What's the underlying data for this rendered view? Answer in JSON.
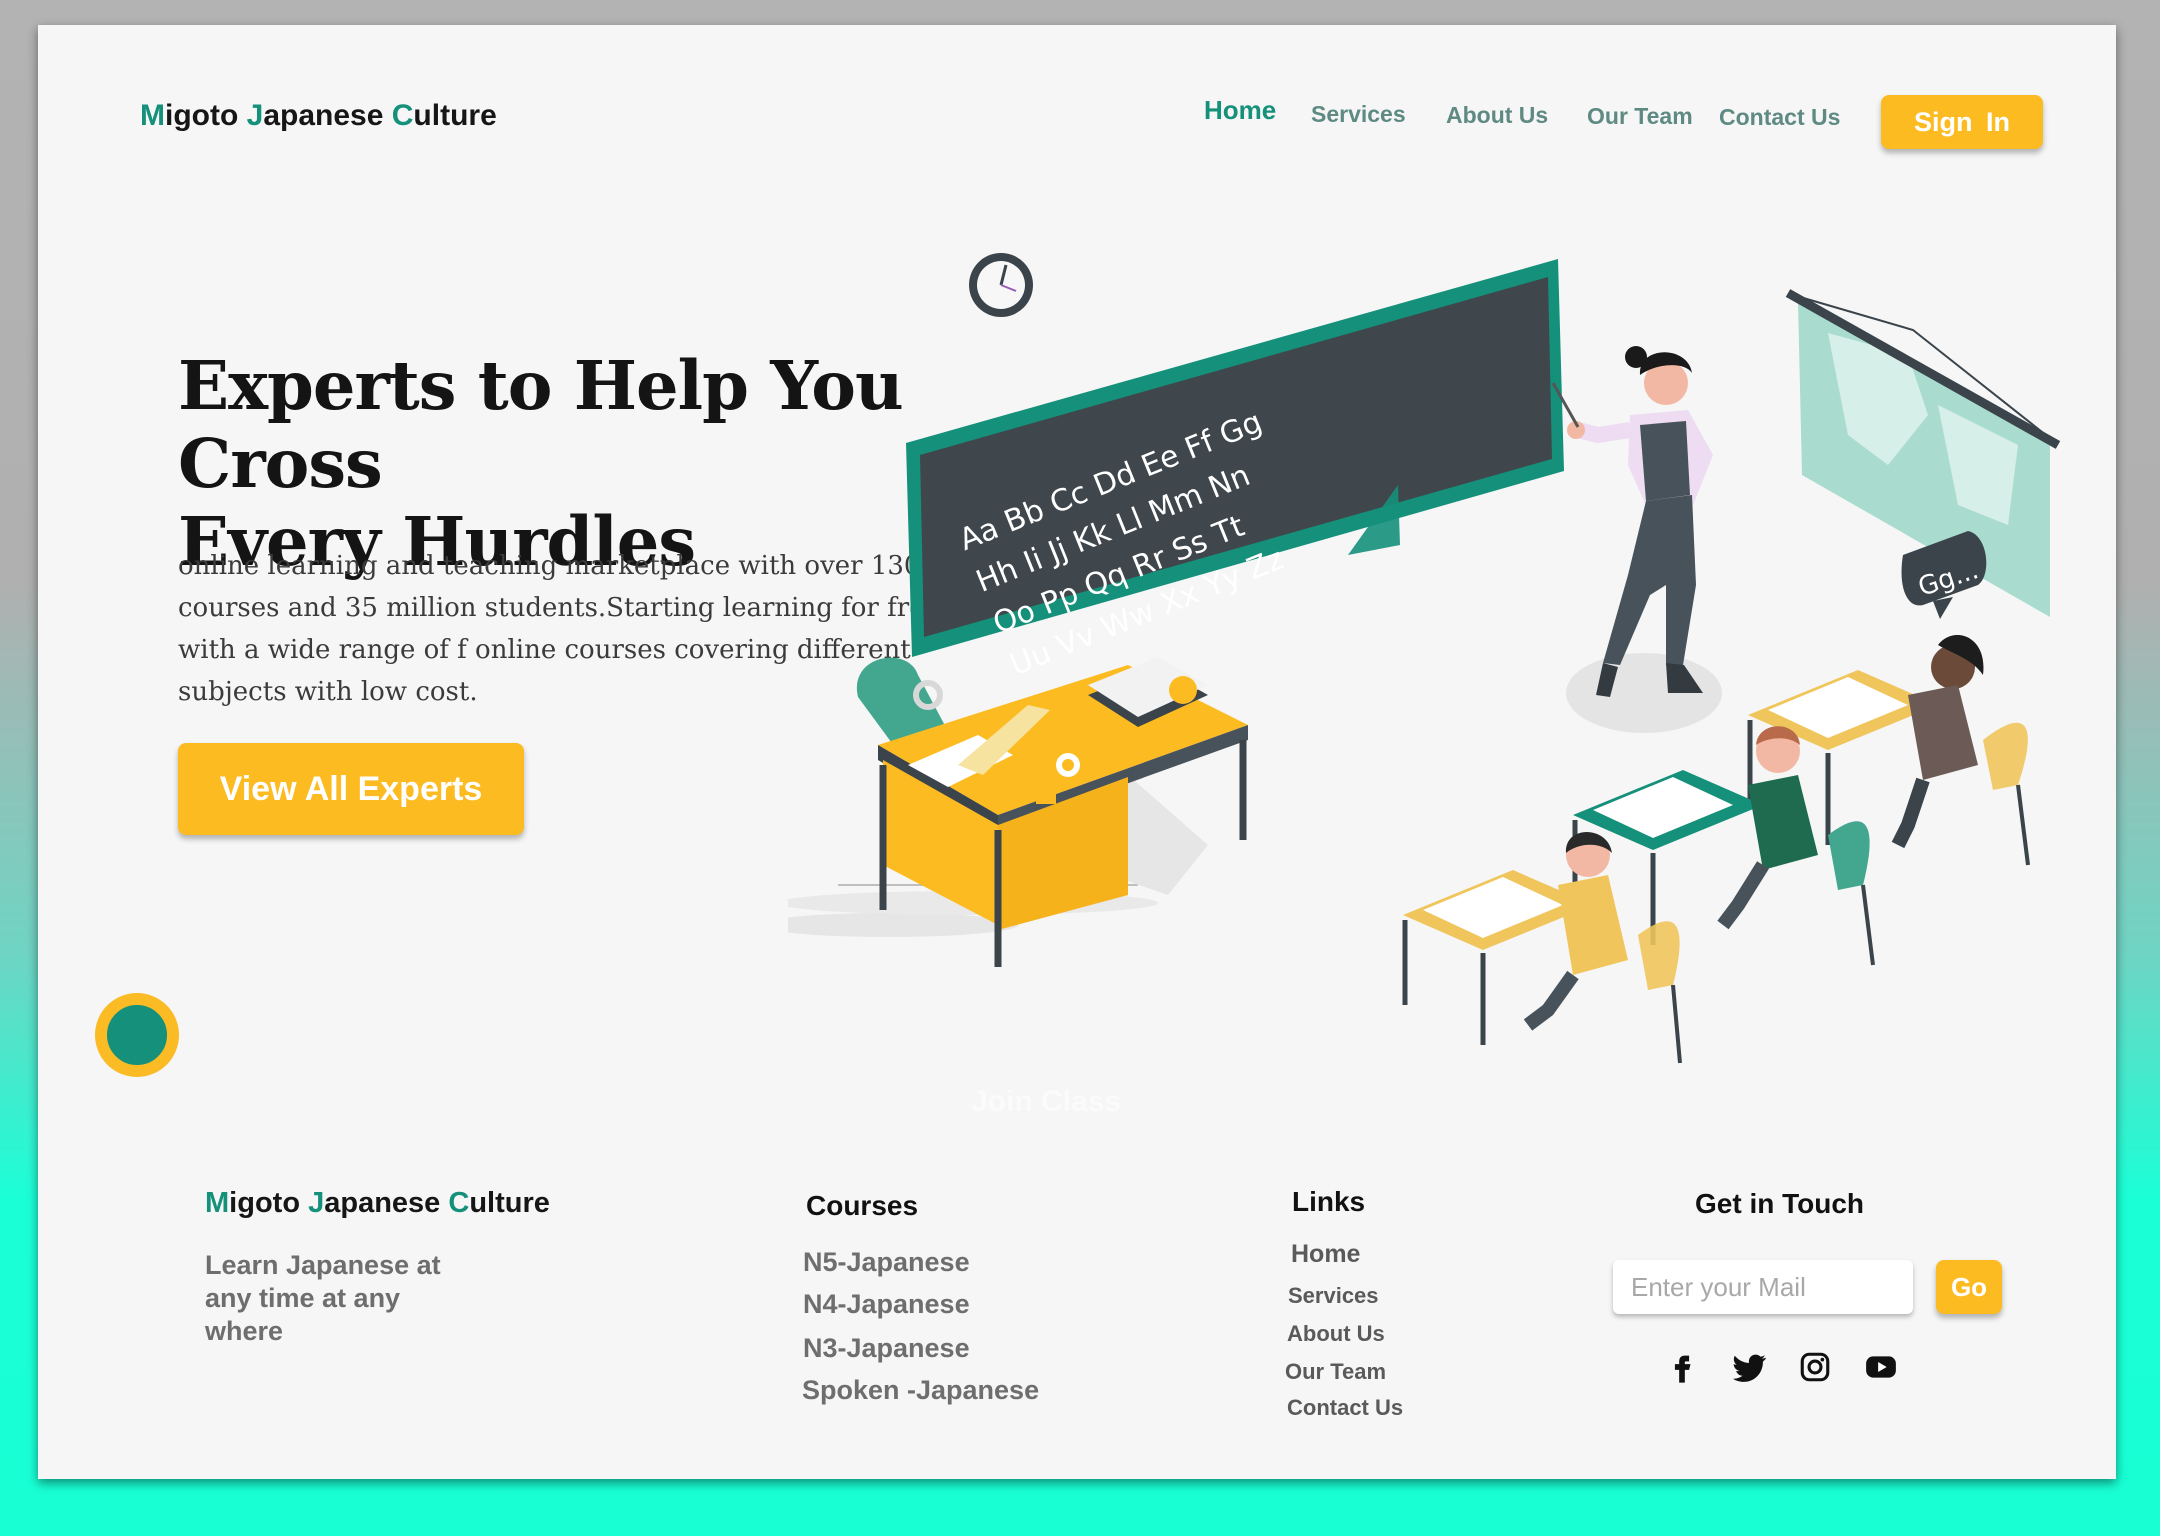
{
  "header": {
    "brand": {
      "l1": "M",
      "r1": "igoto ",
      "l2": "J",
      "r2": "apanese ",
      "l3": "C",
      "r3": "ulture"
    },
    "nav": [
      {
        "label": "Home",
        "active": true
      },
      {
        "label": "Services"
      },
      {
        "label": "About Us"
      },
      {
        "label": "Our Team"
      },
      {
        "label": "Contact Us"
      }
    ],
    "signin_label": "Sign  In"
  },
  "hero": {
    "title_line1": "Experts to Help You Cross",
    "title_line2": "Every Hurdles",
    "text_line1": "online learning and teaching marketplace with over 130000",
    "text_line2": "courses and 35 million students.Starting learning for free",
    "text_line3": "with a wide range of f online courses covering different",
    "text_line4": "subjects with low cost.",
    "cta_label": "View All Experts",
    "join_label": "Join Class"
  },
  "illustration": {
    "board_row1": "Aa Bb Cc Dd Ee Ff Gg",
    "board_row2": "Hh Ii Jj Kk Ll Mm Nn",
    "board_row3": "Oo Pp Qq Rr Ss Tt",
    "board_row4": "Uu Vv Ww Xx Yy Zz",
    "speech": "Gg..."
  },
  "footer": {
    "brand": {
      "l1": "M",
      "r1": "igoto ",
      "l2": "J",
      "r2": "apanese ",
      "l3": "C",
      "r3": "ulture"
    },
    "tagline_line1": "Learn Japanese at",
    "tagline_line2": "any time at any",
    "tagline_line3": "where",
    "courses_heading": "Courses",
    "courses": [
      "N5-Japanese",
      "N4-Japanese",
      "N3-Japanese",
      "Spoken -Japanese"
    ],
    "links_heading": "Links",
    "links": [
      "Home",
      "Services",
      "About Us",
      "Our Team",
      "Contact Us"
    ],
    "touch_heading": "Get in Touch",
    "mail_placeholder": "Enter your Mail",
    "go_label": "Go",
    "social_icons": [
      "facebook-icon",
      "twitter-icon",
      "instagram-icon",
      "youtube-icon"
    ]
  },
  "colors": {
    "accent_green": "#15907a",
    "accent_yellow": "#fdbb22",
    "background_teal": "#1bffd6"
  }
}
